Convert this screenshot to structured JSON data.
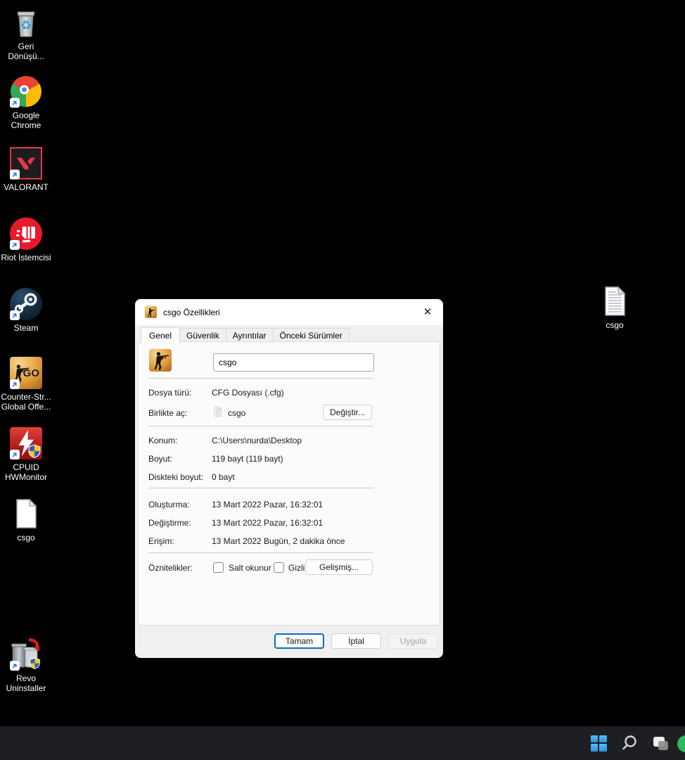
{
  "desktop": {
    "icons": [
      {
        "id": "recycle-bin",
        "label": "Geri\nDönüşü..."
      },
      {
        "id": "google-chrome",
        "label": "Google\nChrome"
      },
      {
        "id": "valorant",
        "label": "VALORANT"
      },
      {
        "id": "riot-client",
        "label": "Riot İstemcisi"
      },
      {
        "id": "steam",
        "label": "Steam"
      },
      {
        "id": "csgo-game",
        "label": "Counter-Str...\nGlobal Offe..."
      },
      {
        "id": "cpuid-hwmonitor",
        "label": "CPUID\nHWMonitor"
      },
      {
        "id": "csgo-file",
        "label": "csgo"
      },
      {
        "id": "revo-uninstaller",
        "label": "Revo\nUninstaller"
      },
      {
        "id": "csgo-file-right",
        "label": "csgo"
      }
    ]
  },
  "dialog": {
    "title": "csgo Özellikleri",
    "tabs": [
      {
        "label": "Genel",
        "active": true
      },
      {
        "label": "Güvenlik",
        "active": false
      },
      {
        "label": "Ayrıntılar",
        "active": false
      },
      {
        "label": "Önceki Sürümler",
        "active": false
      }
    ],
    "filename": "csgo",
    "rows": {
      "file_type": {
        "label": "Dosya türü:",
        "value": "CFG Dosyası (.cfg)"
      },
      "open_with": {
        "label": "Birlikte aç:",
        "value": "csgo",
        "button": "Değiştir..."
      },
      "location": {
        "label": "Konum:",
        "value": "C:\\Users\\nurda\\Desktop"
      },
      "size": {
        "label": "Boyut:",
        "value": "119 bayt (119 bayt)"
      },
      "size_on_disk": {
        "label": "Diskteki boyut:",
        "value": "0 bayt"
      },
      "created": {
        "label": "Oluşturma:",
        "value": "13 Mart 2022 Pazar, 16:32:01"
      },
      "modified": {
        "label": "Değiştirme:",
        "value": "13 Mart 2022 Pazar, 16:32:01"
      },
      "accessed": {
        "label": "Erişim:",
        "value": "13 Mart 2022 Bugün, 2 dakika önce"
      },
      "attributes": {
        "label": "Öznitelikler:",
        "checkbox_readonly": "Salt okunur",
        "checkbox_hidden": "Gizli",
        "button": "Gelişmiş..."
      }
    },
    "buttons": {
      "ok": "Tamam",
      "cancel": "İptal",
      "apply": "Uygula"
    }
  },
  "taskbar": {
    "icons": [
      "start",
      "search",
      "task-view",
      "app-partial-green"
    ]
  },
  "colors": {
    "accent_blue": "#0f6cbd",
    "taskbar_bg": "#1e1f22",
    "start_blue": "#3aa7f0",
    "desktop_bg": "#000000",
    "dialog_bg": "#f0f0f0"
  }
}
